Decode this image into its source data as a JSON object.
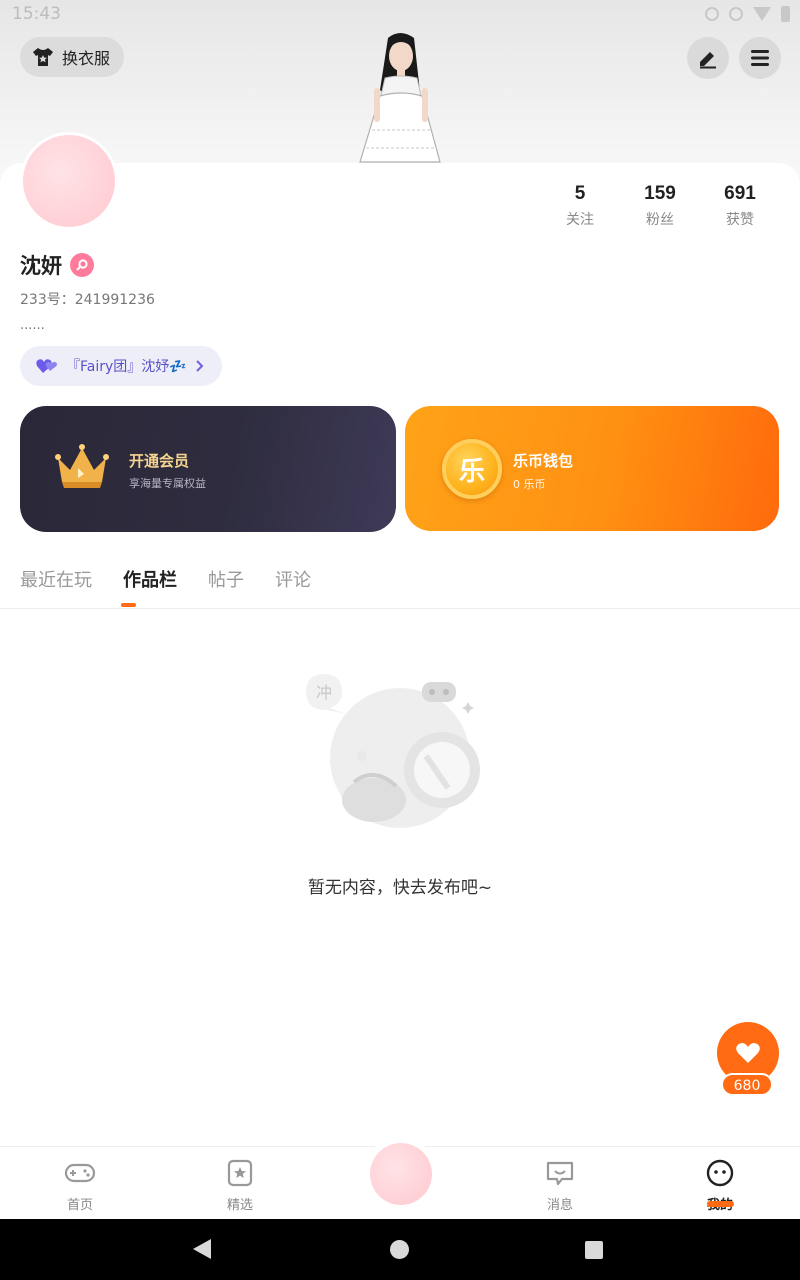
{
  "status_bar": {
    "time": "15:43"
  },
  "header": {
    "outfit_label": "换衣服"
  },
  "profile": {
    "name": "沈妍",
    "id_line": "233号：241991236",
    "bio": "......",
    "group_label": "『Fairy团』沈妤💤",
    "stats": [
      {
        "value": "5",
        "label": "关注"
      },
      {
        "value": "159",
        "label": "粉丝"
      },
      {
        "value": "691",
        "label": "获赞"
      }
    ]
  },
  "cards": {
    "vip": {
      "title": "开通会员",
      "subtitle": "享海量专属权益"
    },
    "wallet": {
      "title": "乐币钱包",
      "subtitle": "0 乐币",
      "coin_glyph": "乐"
    }
  },
  "tabs": [
    {
      "label": "最近在玩",
      "active": false
    },
    {
      "label": "作品栏",
      "active": true
    },
    {
      "label": "帖子",
      "active": false
    },
    {
      "label": "评论",
      "active": false
    }
  ],
  "empty_state": {
    "text": "暂无内容，快去发布吧~",
    "bubble_glyph": "冲"
  },
  "like": {
    "count": "680"
  },
  "bottom_nav": [
    {
      "label": "首页",
      "icon": "gamepad-icon"
    },
    {
      "label": "精选",
      "icon": "star-card-icon"
    },
    {
      "label": "消息",
      "icon": "chat-bubble-icon"
    },
    {
      "label": "我的",
      "icon": "face-icon",
      "active": true
    }
  ],
  "colors": {
    "accent": "#ff6a13",
    "vip_gold": "#f5d58f",
    "group_text": "#5a52c8"
  }
}
